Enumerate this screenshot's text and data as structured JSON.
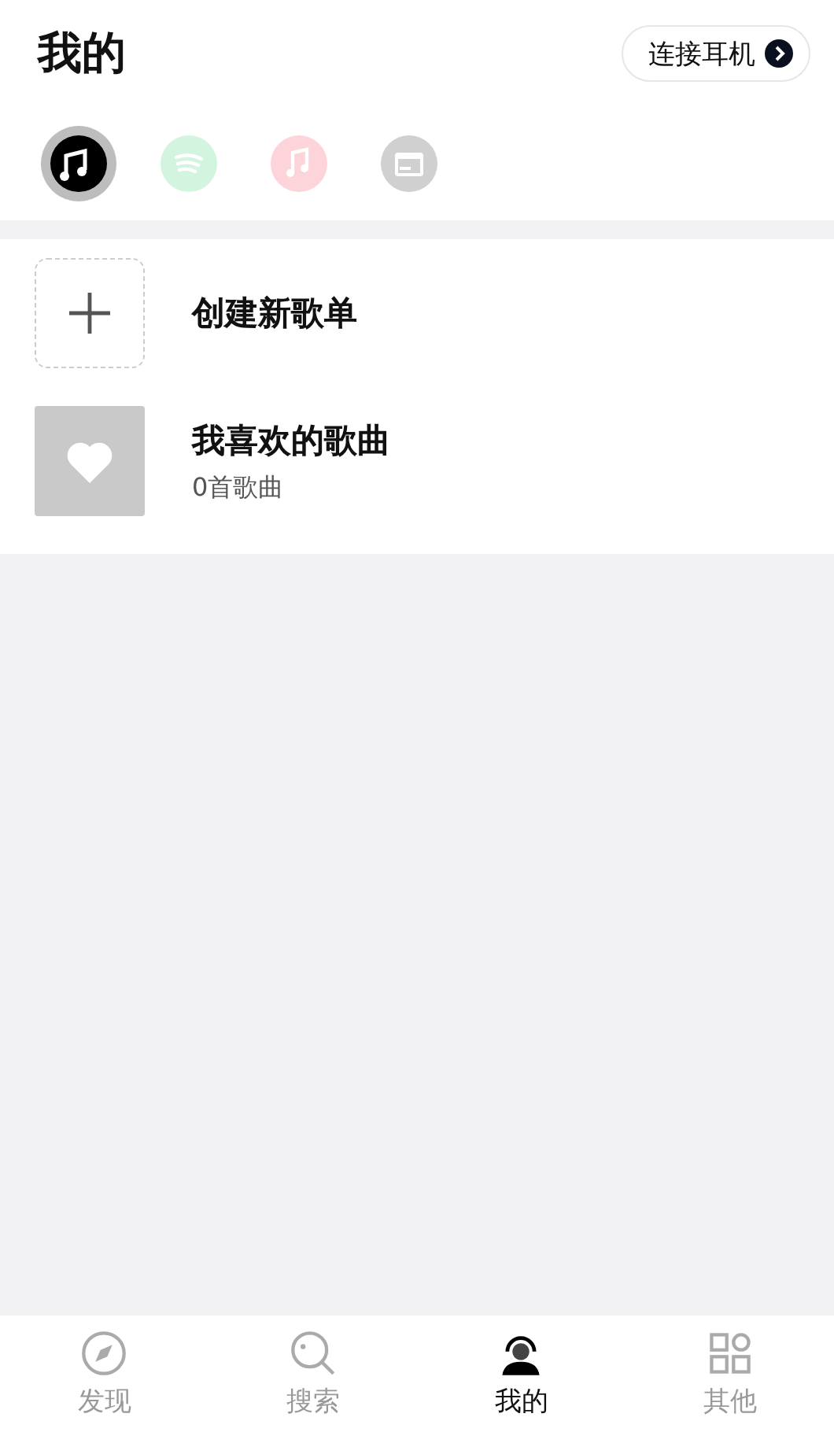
{
  "header": {
    "title": "我的",
    "connect_button": "连接耳机"
  },
  "sources": [
    {
      "kind": "app",
      "selected": true
    },
    {
      "kind": "spotify",
      "selected": false
    },
    {
      "kind": "music",
      "selected": false
    },
    {
      "kind": "folder",
      "selected": false
    }
  ],
  "playlists": [
    {
      "kind": "create",
      "title": "创建新歌单"
    },
    {
      "kind": "liked",
      "title": "我喜欢的歌曲",
      "subtitle": "0首歌曲"
    }
  ],
  "tabs": [
    {
      "kind": "discover",
      "label": "发现",
      "selected": false
    },
    {
      "kind": "search",
      "label": "搜索",
      "selected": false
    },
    {
      "kind": "mine",
      "label": "我的",
      "selected": true
    },
    {
      "kind": "other",
      "label": "其他",
      "selected": false
    }
  ]
}
